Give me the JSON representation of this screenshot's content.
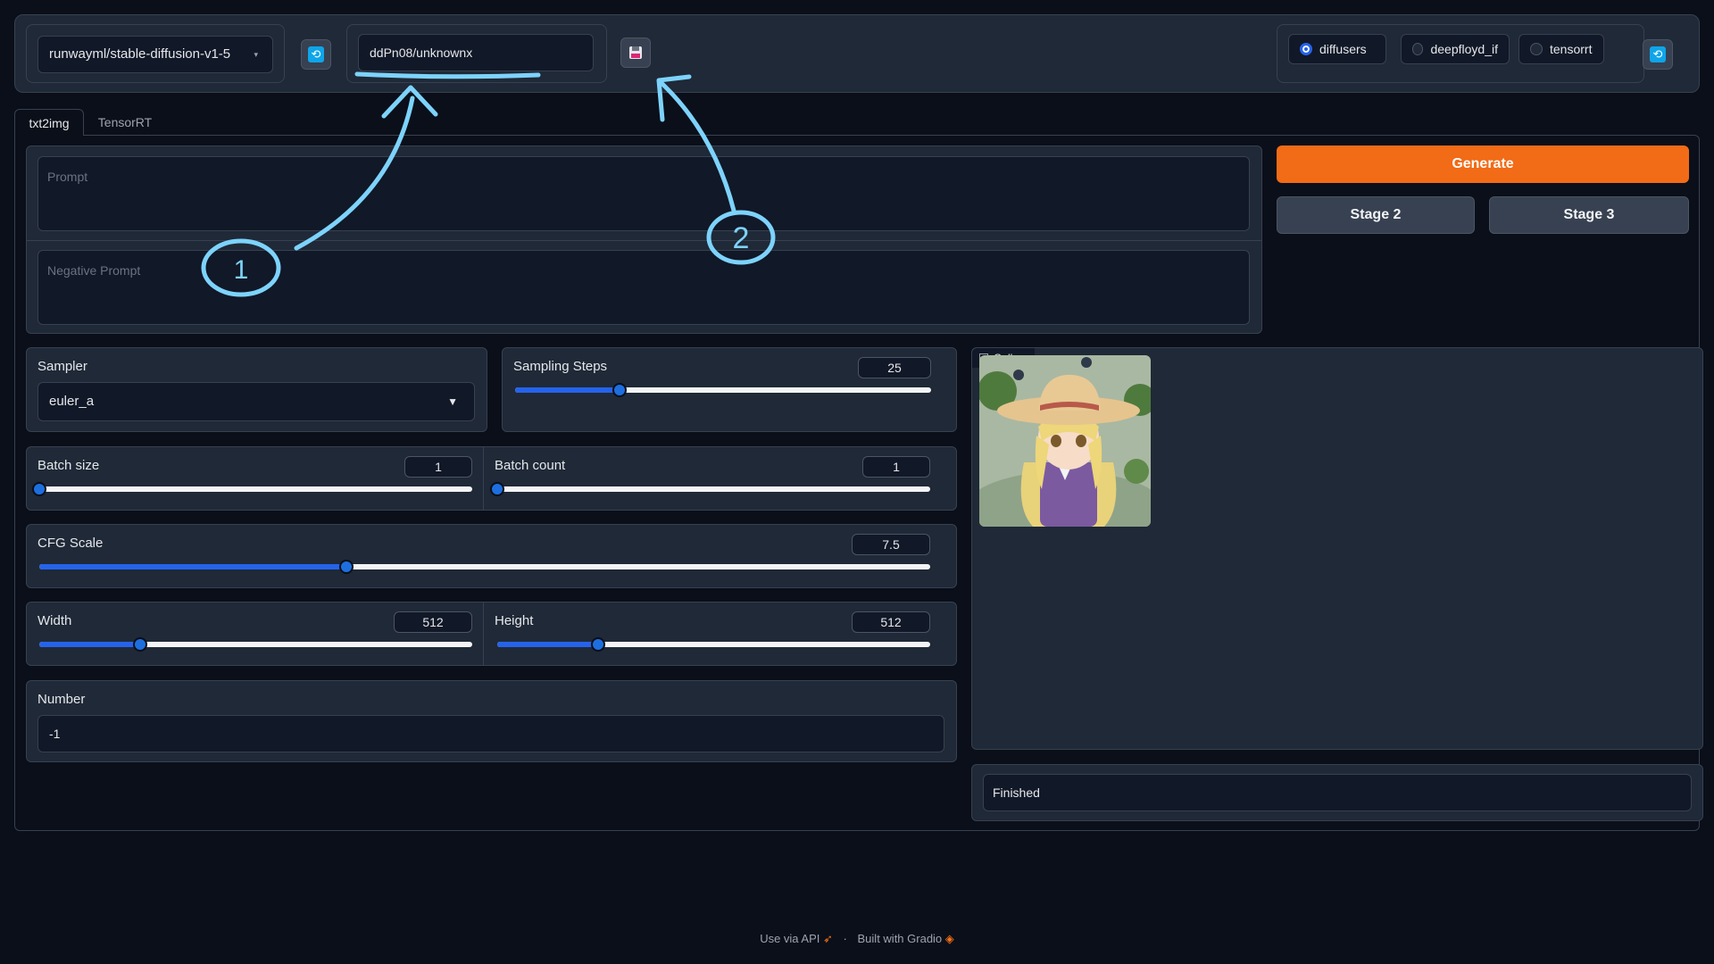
{
  "header": {
    "model_select": "runwayml/stable-diffusion-v1-5",
    "lora_input": "ddPn08/unknownx",
    "backends": [
      {
        "label": "diffusers",
        "selected": true
      },
      {
        "label": "deepfloyd_if",
        "selected": false
      },
      {
        "label": "tensorrt",
        "selected": false
      }
    ]
  },
  "tabs": [
    {
      "label": "txt2img",
      "active": true
    },
    {
      "label": "TensorRT",
      "active": false
    }
  ],
  "prompt": {
    "placeholder": "Prompt"
  },
  "negative_prompt": {
    "placeholder": "Negative Prompt"
  },
  "buttons": {
    "generate": "Generate",
    "stage2": "Stage 2",
    "stage3": "Stage 3"
  },
  "sampler": {
    "label": "Sampler",
    "value": "euler_a"
  },
  "sampling_steps": {
    "label": "Sampling Steps",
    "value": "25",
    "fraction": 0.25
  },
  "batch_size": {
    "label": "Batch size",
    "value": "1",
    "fraction": 0.0
  },
  "batch_count": {
    "label": "Batch count",
    "value": "1",
    "fraction": 0.0
  },
  "cfg_scale": {
    "label": "CFG Scale",
    "value": "7.5",
    "fraction": 0.345
  },
  "width": {
    "label": "Width",
    "value": "512",
    "fraction": 0.233
  },
  "height": {
    "label": "Height",
    "value": "512",
    "fraction": 0.233
  },
  "seed": {
    "label": "Number",
    "value": "-1"
  },
  "gallery": {
    "label": "Gallery"
  },
  "status": {
    "text": "Finished"
  },
  "annotations": {
    "one": "1",
    "two": "2"
  },
  "footer": {
    "api": "Use via API",
    "sep": "·",
    "built": "Built with Gradio"
  },
  "colors": {
    "accent": "#f97316",
    "slider": "#2563eb",
    "annotation": "#7dd3fc",
    "background": "#0b0f19"
  }
}
